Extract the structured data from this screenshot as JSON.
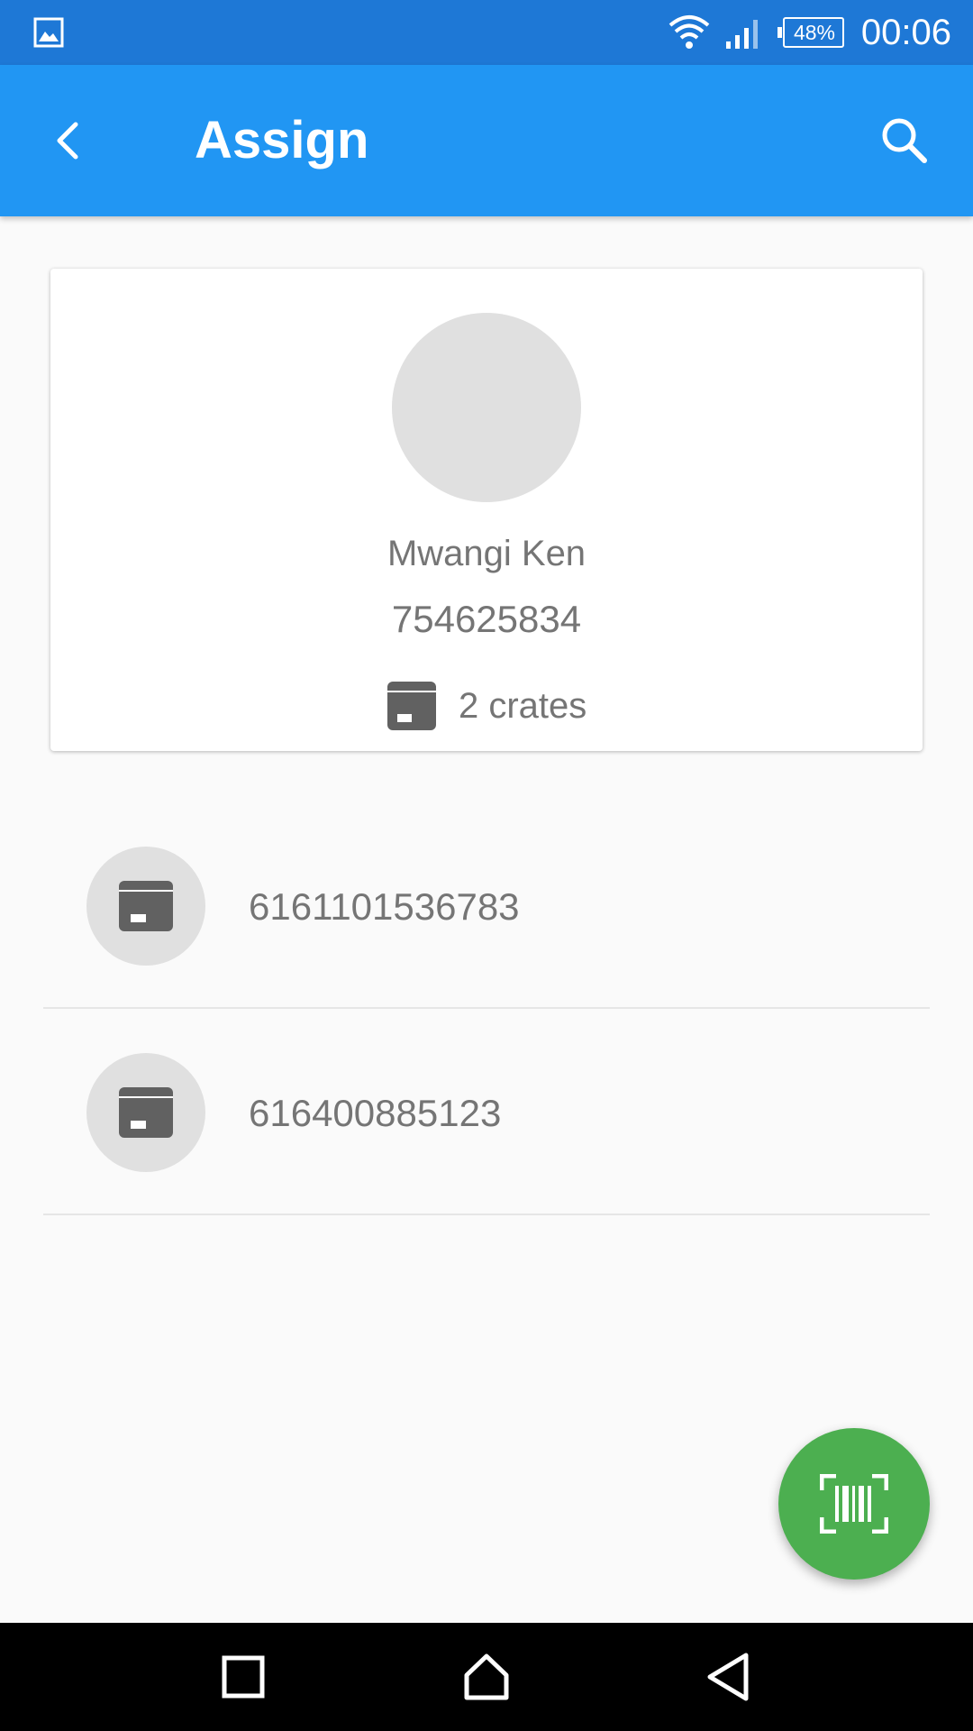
{
  "status_bar": {
    "battery_percent": "48%",
    "time": "00:06",
    "icons": [
      "gallery-notification-icon",
      "wifi-icon",
      "cell-signal-icon",
      "battery-icon"
    ]
  },
  "app_bar": {
    "title": "Assign",
    "background": "#2196f3",
    "icons": [
      "arrow-back-icon",
      "search-icon"
    ]
  },
  "profile": {
    "name": "Mwangi Ken",
    "phone": "754625834",
    "crate_count_label": "2 crates",
    "icon": "crate-icon"
  },
  "crates": [
    {
      "code": "6161101536783",
      "icon": "crate-icon"
    },
    {
      "code": "616400885123",
      "icon": "crate-icon"
    }
  ],
  "fab": {
    "icon": "barcode-scan-icon",
    "color": "#4caf50"
  },
  "nav_bar": {
    "icons": [
      "recents-square-icon",
      "home-icon",
      "back-triangle-icon"
    ]
  }
}
